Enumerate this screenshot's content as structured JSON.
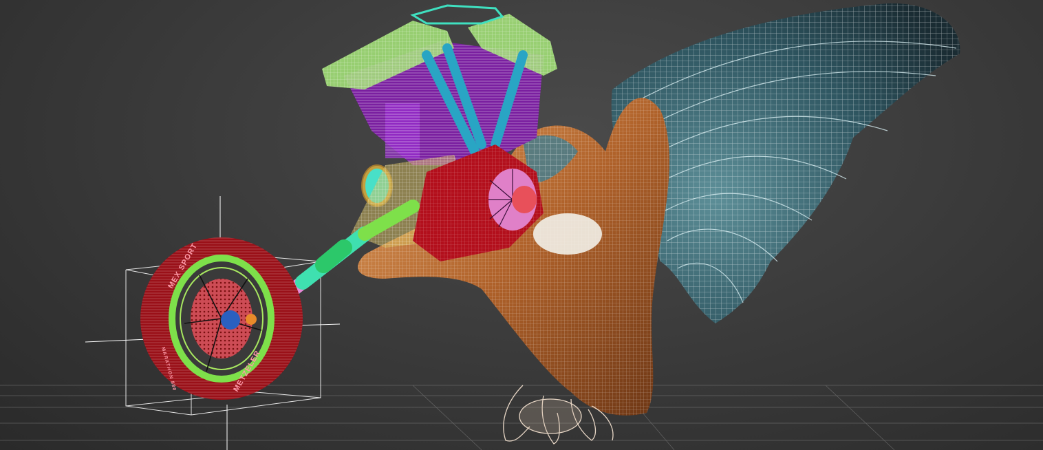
{
  "viewport": {
    "name": "Perspective viewport",
    "background_color": "#3d3d3d",
    "grid_color": "#8a8a8a",
    "shading_mode": "wireframe-over-shaded"
  },
  "scene": {
    "objects": [
      {
        "id": "front-wheel",
        "label": "Front wheel with disc brake",
        "wire_color": "#b3121c"
      },
      {
        "id": "wheel-rim",
        "label": "Spoked rim",
        "wire_color": "#7ee04a"
      },
      {
        "id": "brake-disc",
        "label": "Brake disc",
        "wire_color": "#e8505a"
      },
      {
        "id": "fork",
        "label": "Front fork",
        "wire_color": "#e88ad8"
      },
      {
        "id": "fork-upper",
        "label": "Fork tube",
        "wire_color": "#3fe0b0"
      },
      {
        "id": "engine",
        "label": "V-twin engine",
        "wire_color": "#8a2bb0"
      },
      {
        "id": "cylinder-heads",
        "label": "Cylinder heads",
        "wire_color": "#b6ef8c"
      },
      {
        "id": "pushrods",
        "label": "Pushrod tubes",
        "wire_color": "#2aa7c7"
      },
      {
        "id": "air-cleaner",
        "label": "Air cleaner",
        "wire_color": "#c8102e"
      },
      {
        "id": "gauge",
        "label": "Headlight gauge",
        "wire_color": "#48e0c8"
      },
      {
        "id": "eagle",
        "label": "Eagle body",
        "wire_color": "#c87a3a"
      },
      {
        "id": "eagle-wing",
        "label": "Eagle wing",
        "wire_color": "#9fd0dc"
      }
    ],
    "tire_text": {
      "brand": "METZELER",
      "model": "MEX  SPORT",
      "small": "MARATHON 880"
    }
  }
}
